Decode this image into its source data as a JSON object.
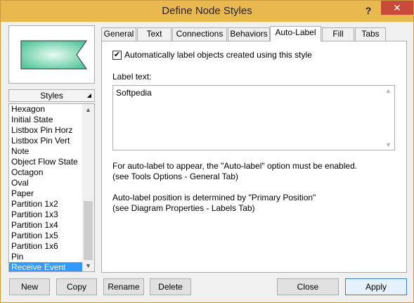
{
  "window": {
    "title": "Define Node Styles",
    "help_label": "?",
    "close_label": "✕"
  },
  "styles_panel": {
    "header": "Styles",
    "items": [
      "Hexagon",
      "Initial State",
      "Listbox Pin Horz",
      "Listbox Pin Vert",
      "Note",
      "Object Flow State",
      "Octagon",
      "Oval",
      "Paper",
      "Partition 1x2",
      "Partition 1x3",
      "Partition 1x4",
      "Partition 1x5",
      "Partition 1x6",
      "Pin",
      "Receive Event"
    ],
    "selected": "Receive Event"
  },
  "tabs": [
    "General",
    "Text",
    "Connections",
    "Behaviors",
    "Auto-Label",
    "Fill",
    "Tabs"
  ],
  "active_tab": "Auto-Label",
  "auto_label": {
    "checkbox_label": "Automatically label objects created using this style",
    "checked": true,
    "label_text_caption": "Label text:",
    "label_text_value": "Softpedia",
    "info1_line1": "For auto-label to appear, the \"Auto-label\" option must be enabled.",
    "info1_line2": "(see Tools Options - General Tab)",
    "info2_line1": "Auto-label position is determined by \"Primary Position\"",
    "info2_line2": "(see Diagram Properties - Labels Tab)"
  },
  "buttons": {
    "new": "New",
    "copy": "Copy",
    "rename": "Rename",
    "delete": "Delete",
    "close": "Close",
    "apply": "Apply"
  },
  "colors": {
    "titlebar": "#e9b84e",
    "close": "#c74a3b",
    "selection": "#3399ff",
    "shape_fill": "#7fd9b5"
  }
}
